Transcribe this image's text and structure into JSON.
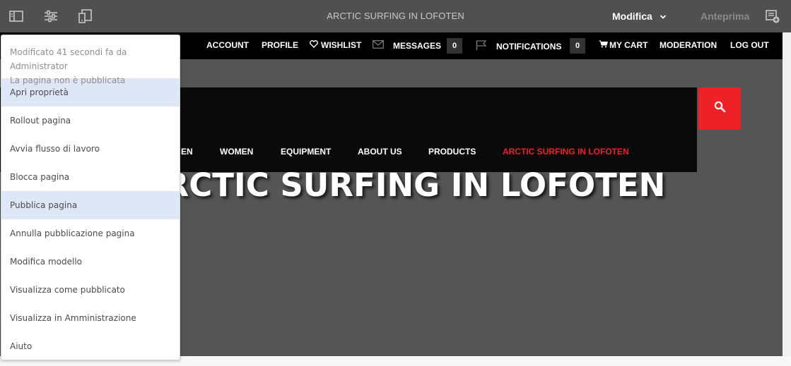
{
  "editor": {
    "page_title": "ARCTIC SURFING IN LOFOTEN",
    "mode": "Modifica",
    "preview": "Anteprima",
    "icons": [
      "side-panel-icon",
      "page-properties-icon",
      "emulator-icon",
      "annotate-icon"
    ]
  },
  "site_nav": {
    "account": "ACCOUNT",
    "profile": "PROFILE",
    "wishlist": "WISHLIST",
    "messages": "MESSAGES",
    "messages_count": "0",
    "notifications": "NOTIFICATIONS",
    "notifications_count": "0",
    "cart": "MY CART",
    "moderation": "MODERATION",
    "logout": "LOG OUT"
  },
  "main_nav": {
    "men_partial": "EN",
    "women": "WOMEN",
    "equipment": "EQUIPMENT",
    "about": "ABOUT US",
    "products": "PRODUCTS",
    "current": "ARCTIC SURFING IN LOFOTEN"
  },
  "hero": {
    "title": "ARCTIC SURFING IN LOFOTEN"
  },
  "page_menu": {
    "modified": "Modificato 41 secondi fa da Administrator",
    "status": "La pagina non è pubblicata",
    "items": [
      "Apri proprietà",
      "Rollout pagina",
      "Avvia flusso di lavoro",
      "Blocca pagina",
      "Pubblica pagina",
      "Annulla pubblicazione pagina",
      "Modifica modello",
      "Visualizza come pubblicato",
      "Visualizza in Amministrazione",
      "Aiuto"
    ]
  },
  "colors": {
    "editor_bar": "#505050",
    "canvas": "#555555",
    "accent_red": "#ee2127",
    "menu_highlight": "#dde7f5"
  }
}
